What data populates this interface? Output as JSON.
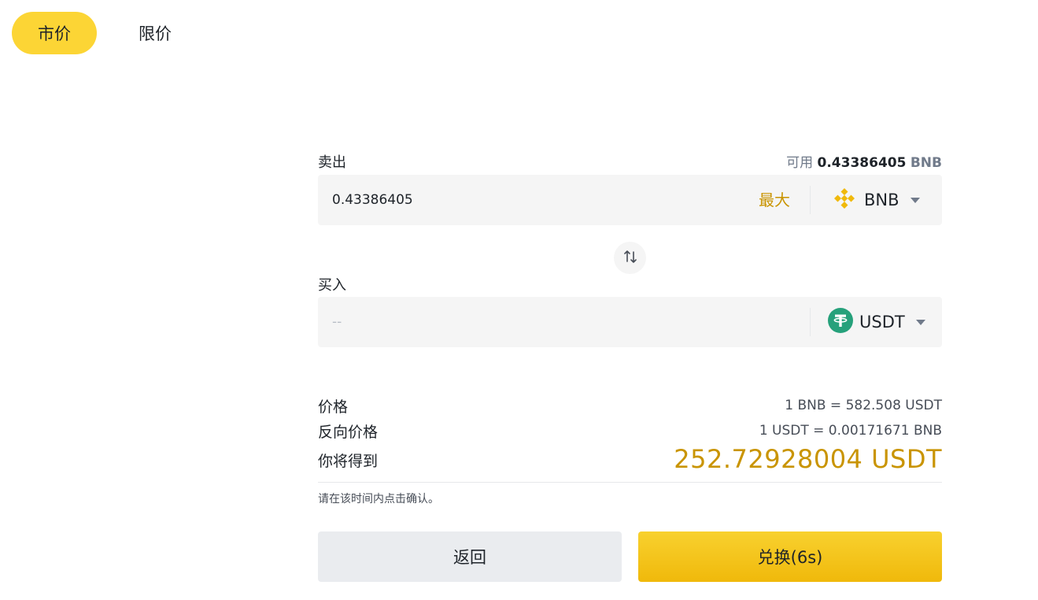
{
  "tabs": {
    "market": "市价",
    "limit": "限价"
  },
  "sell": {
    "label": "卖出",
    "available_prefix": "可用",
    "available_amount": "0.43386405",
    "available_unit": "BNB",
    "amount": "0.43386405",
    "max_label": "最大",
    "coin": "BNB",
    "coin_icon": "bnb-logo-icon"
  },
  "swap_icon": "swap-arrows-icon",
  "buy": {
    "label": "买入",
    "amount_placeholder": "--",
    "coin": "USDT",
    "coin_icon": "usdt-logo-icon"
  },
  "info": {
    "price_label": "价格",
    "price_value": "1 BNB = 582.508 USDT",
    "inverse_label": "反向价格",
    "inverse_value": "1 USDT = 0.00171671 BNB",
    "receive_label": "你将得到",
    "receive_value": "252.72928004 USDT",
    "hint": "请在该时间内点击确认。"
  },
  "actions": {
    "back": "返回",
    "confirm": "兑换(6s)"
  },
  "colors": {
    "accent": "#FCD535",
    "gold_text": "#C99400",
    "bnb": "#F0B90B",
    "usdt": "#26A17B"
  }
}
